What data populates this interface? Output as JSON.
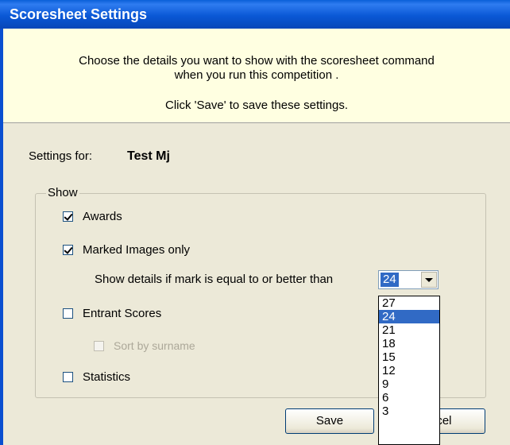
{
  "window": {
    "title": "Scoresheet Settings"
  },
  "header": {
    "line1": "Choose the details you want to show with the scoresheet command",
    "line2": "when you run this competition .",
    "line3": "Click 'Save' to save these settings."
  },
  "settings": {
    "label": "Settings for:",
    "value": "Test Mj"
  },
  "show_group": {
    "legend": "Show",
    "awards": {
      "label": "Awards",
      "checked": true
    },
    "marked_images": {
      "label": "Marked Images only",
      "checked": true
    },
    "details_label": "Show details if mark is equal to or better than",
    "combo_value": "24",
    "entrant_scores": {
      "label": "Entrant Scores",
      "checked": false
    },
    "sort_by_surname": {
      "label": "Sort by surname",
      "checked": false,
      "disabled": true
    },
    "statistics": {
      "label": "Statistics",
      "checked": false
    }
  },
  "dropdown": {
    "options": [
      "27",
      "24",
      "21",
      "18",
      "15",
      "12",
      "9",
      "6",
      "3"
    ],
    "selected": "24"
  },
  "buttons": {
    "save": "Save",
    "cancel": "ncel"
  }
}
